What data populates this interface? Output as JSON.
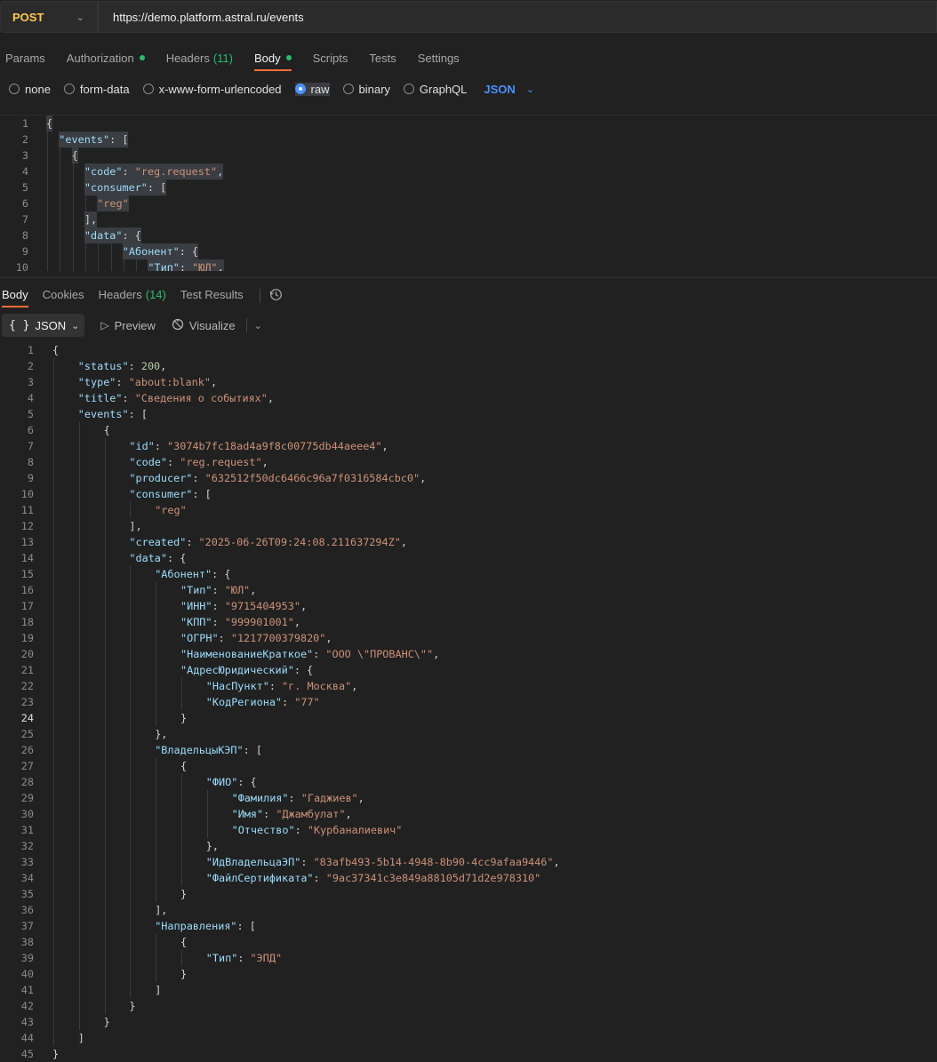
{
  "request": {
    "method": "POST",
    "url": "https://demo.platform.astral.ru/events"
  },
  "request_tabs": [
    {
      "label": "Params",
      "dot": false,
      "count": ""
    },
    {
      "label": "Authorization",
      "dot": true,
      "count": ""
    },
    {
      "label": "Headers",
      "dot": false,
      "count": "(11)"
    },
    {
      "label": "Body",
      "dot": true,
      "count": "",
      "active": true
    },
    {
      "label": "Scripts",
      "dot": false,
      "count": ""
    },
    {
      "label": "Tests",
      "dot": false,
      "count": ""
    },
    {
      "label": "Settings",
      "dot": false,
      "count": ""
    }
  ],
  "body_modes": [
    {
      "label": "none",
      "selected": false
    },
    {
      "label": "form-data",
      "selected": false
    },
    {
      "label": "x-www-form-urlencoded",
      "selected": false
    },
    {
      "label": "raw",
      "selected": true
    },
    {
      "label": "binary",
      "selected": false
    },
    {
      "label": "GraphQL",
      "selected": false
    }
  ],
  "body_language": "JSON",
  "request_body_lines": [
    {
      "n": "1",
      "indent": 0,
      "tokens": [
        [
          "p",
          "{"
        ]
      ]
    },
    {
      "n": "2",
      "indent": 1,
      "tokens": [
        [
          "k",
          "\"events\""
        ],
        [
          "p",
          ": ["
        ]
      ]
    },
    {
      "n": "3",
      "indent": 2,
      "tokens": [
        [
          "p",
          "{"
        ]
      ]
    },
    {
      "n": "4",
      "indent": 3,
      "tokens": [
        [
          "k",
          "\"code\""
        ],
        [
          "p",
          ": "
        ],
        [
          "s",
          "\"reg.request\""
        ],
        [
          "p",
          ","
        ]
      ]
    },
    {
      "n": "5",
      "indent": 3,
      "tokens": [
        [
          "k",
          "\"consumer\""
        ],
        [
          "p",
          ": ["
        ]
      ]
    },
    {
      "n": "6",
      "indent": 4,
      "tokens": [
        [
          "s",
          "\"reg\""
        ]
      ]
    },
    {
      "n": "7",
      "indent": 3,
      "tokens": [
        [
          "p",
          "],"
        ]
      ]
    },
    {
      "n": "8",
      "indent": 3,
      "tokens": [
        [
          "k",
          "\"data\""
        ],
        [
          "p",
          ": {"
        ]
      ]
    },
    {
      "n": "9",
      "indent": 6,
      "tokens": [
        [
          "k",
          "\"Абонент\""
        ],
        [
          "p",
          ": {"
        ]
      ]
    },
    {
      "n": "10",
      "indent": 8,
      "tokens": [
        [
          "k",
          "\"Тип\""
        ],
        [
          "p",
          ": "
        ],
        [
          "s",
          "\"ЮЛ\""
        ],
        [
          "p",
          ","
        ]
      ]
    }
  ],
  "response_tabs": [
    {
      "label": "Body",
      "count": "",
      "active": true
    },
    {
      "label": "Cookies",
      "count": ""
    },
    {
      "label": "Headers",
      "count": "(14)"
    },
    {
      "label": "Test Results",
      "count": ""
    }
  ],
  "response_tools": {
    "format": "JSON",
    "format_icon": "{ }",
    "preview": "Preview",
    "visualize": "Visualize"
  },
  "icons": {
    "method_chevron": "chevron-down-icon",
    "history": "history-icon",
    "preview": "play-icon",
    "visualize": "visualize-icon"
  },
  "colors": {
    "accent": "#ff6c37",
    "method": "#ffc94d",
    "status_dot": "#2bbd6e",
    "link": "#4a90ff",
    "json_key": "#9cdcfe",
    "json_string": "#ce9178",
    "json_number": "#b5cea8"
  },
  "response_body_lines": [
    {
      "n": "1",
      "indent": 0,
      "tokens": [
        [
          "p",
          "{"
        ]
      ]
    },
    {
      "n": "2",
      "indent": 1,
      "tokens": [
        [
          "k",
          "\"status\""
        ],
        [
          "p",
          ": "
        ],
        [
          "n",
          "200"
        ],
        [
          "p",
          ","
        ]
      ]
    },
    {
      "n": "3",
      "indent": 1,
      "tokens": [
        [
          "k",
          "\"type\""
        ],
        [
          "p",
          ": "
        ],
        [
          "s",
          "\"about:blank\""
        ],
        [
          "p",
          ","
        ]
      ]
    },
    {
      "n": "4",
      "indent": 1,
      "tokens": [
        [
          "k",
          "\"title\""
        ],
        [
          "p",
          ": "
        ],
        [
          "s",
          "\"Сведения о событиях\""
        ],
        [
          "p",
          ","
        ]
      ]
    },
    {
      "n": "5",
      "indent": 1,
      "tokens": [
        [
          "k",
          "\"events\""
        ],
        [
          "p",
          ": ["
        ]
      ]
    },
    {
      "n": "6",
      "indent": 2,
      "tokens": [
        [
          "p",
          "{"
        ]
      ]
    },
    {
      "n": "7",
      "indent": 3,
      "tokens": [
        [
          "k",
          "\"id\""
        ],
        [
          "p",
          ": "
        ],
        [
          "s",
          "\"3074b7fc18ad4a9f8c00775db44aeee4\""
        ],
        [
          "p",
          ","
        ]
      ]
    },
    {
      "n": "8",
      "indent": 3,
      "tokens": [
        [
          "k",
          "\"code\""
        ],
        [
          "p",
          ": "
        ],
        [
          "s",
          "\"reg.request\""
        ],
        [
          "p",
          ","
        ]
      ]
    },
    {
      "n": "9",
      "indent": 3,
      "tokens": [
        [
          "k",
          "\"producer\""
        ],
        [
          "p",
          ": "
        ],
        [
          "s",
          "\"632512f50dc6466c96a7f0316584cbc0\""
        ],
        [
          "p",
          ","
        ]
      ]
    },
    {
      "n": "10",
      "indent": 3,
      "tokens": [
        [
          "k",
          "\"consumer\""
        ],
        [
          "p",
          ": ["
        ]
      ]
    },
    {
      "n": "11",
      "indent": 4,
      "tokens": [
        [
          "s",
          "\"reg\""
        ]
      ]
    },
    {
      "n": "12",
      "indent": 3,
      "tokens": [
        [
          "p",
          "],"
        ]
      ]
    },
    {
      "n": "13",
      "indent": 3,
      "tokens": [
        [
          "k",
          "\"created\""
        ],
        [
          "p",
          ": "
        ],
        [
          "s",
          "\"2025-06-26T09:24:08.211637294Z\""
        ],
        [
          "p",
          ","
        ]
      ]
    },
    {
      "n": "14",
      "indent": 3,
      "tokens": [
        [
          "k",
          "\"data\""
        ],
        [
          "p",
          ": {"
        ]
      ]
    },
    {
      "n": "15",
      "indent": 4,
      "tokens": [
        [
          "k",
          "\"Абонент\""
        ],
        [
          "p",
          ": {"
        ]
      ]
    },
    {
      "n": "16",
      "indent": 5,
      "tokens": [
        [
          "k",
          "\"Тип\""
        ],
        [
          "p",
          ": "
        ],
        [
          "s",
          "\"ЮЛ\""
        ],
        [
          "p",
          ","
        ]
      ]
    },
    {
      "n": "17",
      "indent": 5,
      "tokens": [
        [
          "k",
          "\"ИНН\""
        ],
        [
          "p",
          ": "
        ],
        [
          "s",
          "\"9715404953\""
        ],
        [
          "p",
          ","
        ]
      ]
    },
    {
      "n": "18",
      "indent": 5,
      "tokens": [
        [
          "k",
          "\"КПП\""
        ],
        [
          "p",
          ": "
        ],
        [
          "s",
          "\"999901001\""
        ],
        [
          "p",
          ","
        ]
      ]
    },
    {
      "n": "19",
      "indent": 5,
      "tokens": [
        [
          "k",
          "\"ОГРН\""
        ],
        [
          "p",
          ": "
        ],
        [
          "s",
          "\"1217700379820\""
        ],
        [
          "p",
          ","
        ]
      ]
    },
    {
      "n": "20",
      "indent": 5,
      "tokens": [
        [
          "k",
          "\"НаименованиеКраткое\""
        ],
        [
          "p",
          ": "
        ],
        [
          "s",
          "\"ООО \\\"ПРОВАНС\\\"\""
        ],
        [
          "p",
          ","
        ]
      ]
    },
    {
      "n": "21",
      "indent": 5,
      "tokens": [
        [
          "k",
          "\"АдресЮридический\""
        ],
        [
          "p",
          ": {"
        ]
      ]
    },
    {
      "n": "22",
      "indent": 6,
      "tokens": [
        [
          "k",
          "\"НасПункт\""
        ],
        [
          "p",
          ": "
        ],
        [
          "s",
          "\"г. Москва\""
        ],
        [
          "p",
          ","
        ]
      ]
    },
    {
      "n": "23",
      "indent": 6,
      "tokens": [
        [
          "k",
          "\"КодРегиона\""
        ],
        [
          "p",
          ": "
        ],
        [
          "s",
          "\"77\""
        ]
      ]
    },
    {
      "n": "24",
      "indent": 5,
      "tokens": [
        [
          "p",
          "}"
        ]
      ],
      "current": true
    },
    {
      "n": "25",
      "indent": 4,
      "tokens": [
        [
          "p",
          "},"
        ]
      ]
    },
    {
      "n": "26",
      "indent": 4,
      "tokens": [
        [
          "k",
          "\"ВладельцыКЭП\""
        ],
        [
          "p",
          ": ["
        ]
      ]
    },
    {
      "n": "27",
      "indent": 5,
      "tokens": [
        [
          "p",
          "{"
        ]
      ]
    },
    {
      "n": "28",
      "indent": 6,
      "tokens": [
        [
          "k",
          "\"ФИО\""
        ],
        [
          "p",
          ": {"
        ]
      ]
    },
    {
      "n": "29",
      "indent": 7,
      "tokens": [
        [
          "k",
          "\"Фамилия\""
        ],
        [
          "p",
          ": "
        ],
        [
          "s",
          "\"Гаджиев\""
        ],
        [
          "p",
          ","
        ]
      ]
    },
    {
      "n": "30",
      "indent": 7,
      "tokens": [
        [
          "k",
          "\"Имя\""
        ],
        [
          "p",
          ": "
        ],
        [
          "s",
          "\"Джамбулат\""
        ],
        [
          "p",
          ","
        ]
      ]
    },
    {
      "n": "31",
      "indent": 7,
      "tokens": [
        [
          "k",
          "\"Отчество\""
        ],
        [
          "p",
          ": "
        ],
        [
          "s",
          "\"Курбаналиевич\""
        ]
      ]
    },
    {
      "n": "32",
      "indent": 6,
      "tokens": [
        [
          "p",
          "},"
        ]
      ]
    },
    {
      "n": "33",
      "indent": 6,
      "tokens": [
        [
          "k",
          "\"ИдВладельцаЭП\""
        ],
        [
          "p",
          ": "
        ],
        [
          "s",
          "\"83afb493-5b14-4948-8b90-4cc9afaa9446\""
        ],
        [
          "p",
          ","
        ]
      ]
    },
    {
      "n": "34",
      "indent": 6,
      "tokens": [
        [
          "k",
          "\"ФайлСертификата\""
        ],
        [
          "p",
          ": "
        ],
        [
          "s",
          "\"9ac37341c3e849a88105d71d2e978310\""
        ]
      ]
    },
    {
      "n": "35",
      "indent": 5,
      "tokens": [
        [
          "p",
          "}"
        ]
      ]
    },
    {
      "n": "36",
      "indent": 4,
      "tokens": [
        [
          "p",
          "],"
        ]
      ]
    },
    {
      "n": "37",
      "indent": 4,
      "tokens": [
        [
          "k",
          "\"Направления\""
        ],
        [
          "p",
          ": ["
        ]
      ]
    },
    {
      "n": "38",
      "indent": 5,
      "tokens": [
        [
          "p",
          "{"
        ]
      ]
    },
    {
      "n": "39",
      "indent": 6,
      "tokens": [
        [
          "k",
          "\"Тип\""
        ],
        [
          "p",
          ": "
        ],
        [
          "s",
          "\"ЭПД\""
        ]
      ]
    },
    {
      "n": "40",
      "indent": 5,
      "tokens": [
        [
          "p",
          "}"
        ]
      ]
    },
    {
      "n": "41",
      "indent": 4,
      "tokens": [
        [
          "p",
          "]"
        ]
      ]
    },
    {
      "n": "42",
      "indent": 3,
      "tokens": [
        [
          "p",
          "}"
        ]
      ]
    },
    {
      "n": "43",
      "indent": 2,
      "tokens": [
        [
          "p",
          "}"
        ]
      ]
    },
    {
      "n": "44",
      "indent": 1,
      "tokens": [
        [
          "p",
          "]"
        ]
      ]
    },
    {
      "n": "45",
      "indent": 0,
      "tokens": [
        [
          "p",
          "}"
        ]
      ]
    }
  ]
}
